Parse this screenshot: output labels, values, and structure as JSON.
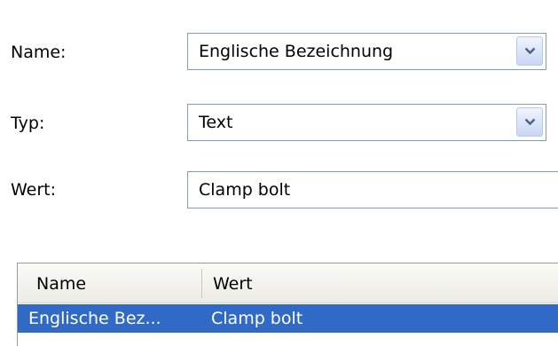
{
  "form": {
    "name_label": "Name:",
    "name_value": "Englische Bezeichnung",
    "type_label": "Typ:",
    "type_value": "Text",
    "value_label": "Wert:",
    "value_value": "Clamp bolt"
  },
  "list": {
    "columns": [
      "Name",
      "Wert"
    ],
    "rows": [
      {
        "name": "Englische Bez...",
        "value": "Clamp bolt",
        "selected": true
      }
    ]
  },
  "colors": {
    "selection": "#316ac5",
    "field_border": "#7f9db9"
  },
  "icons": {
    "dropdown": "chevron-down-icon"
  }
}
